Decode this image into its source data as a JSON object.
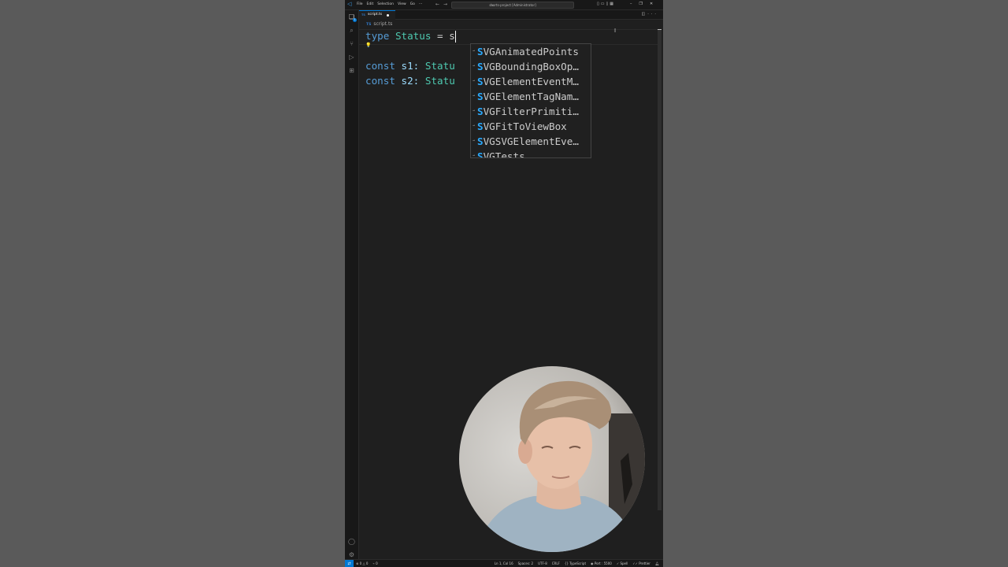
{
  "titlebar": {
    "menu": [
      "File",
      "Edit",
      "Selection",
      "View",
      "Go",
      "···"
    ],
    "command_center": "shorts-project [Administrator]"
  },
  "tab": {
    "file_name": "script.ts",
    "lang_badge": "TS"
  },
  "breadcrumb": {
    "lang_badge": "TS",
    "file": "script.ts"
  },
  "editor": {
    "line1": {
      "kw": "type",
      "name": "Status",
      "op": "=",
      "typed": "s"
    },
    "line3": {
      "kw": "const",
      "name": "s1:",
      "type": "Statu"
    },
    "line4": {
      "kw": "const",
      "name": "s2:",
      "type": "Statu"
    }
  },
  "suggestions": [
    {
      "match": "S",
      "rest": "VGAnimatedPoints"
    },
    {
      "match": "S",
      "rest": "VGBoundingBoxOp…"
    },
    {
      "match": "S",
      "rest": "VGElementEventM…"
    },
    {
      "match": "S",
      "rest": "VGElementTagNam…"
    },
    {
      "match": "S",
      "rest": "VGFilterPrimiti…"
    },
    {
      "match": "S",
      "rest": "VGFitToViewBox"
    },
    {
      "match": "S",
      "rest": "VGSVGElementEve…"
    },
    {
      "match": "S",
      "rest": "VGTests"
    }
  ],
  "status": {
    "errors": "0",
    "warnings": "0",
    "ports": "0",
    "position": "Ln 1, Col 16",
    "spaces": "Spaces: 2",
    "encoding": "UTF-8",
    "eol": "CRLF",
    "language": "TypeScript",
    "port": "Port : 5500",
    "spell": "Spell",
    "formatter": "Prettier"
  },
  "colors": {
    "editor_bg": "#1f1f1f",
    "keyword": "#569cd6",
    "type": "#4ec9b0",
    "identifier": "#9cdcfe",
    "match": "#2aaaff",
    "accent": "#0078d4"
  }
}
